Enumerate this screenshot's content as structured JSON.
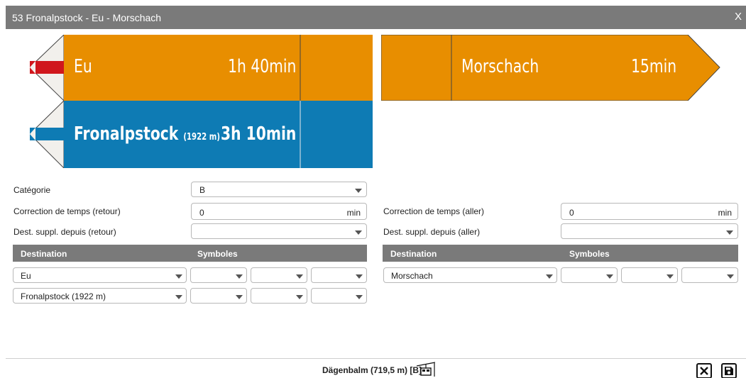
{
  "window": {
    "title": "53 Fronalpstock - Eu - Morschach",
    "close_label": "X"
  },
  "colors": {
    "orange": "#e88e00",
    "blue": "#0e7bb4",
    "red": "#d0171d",
    "header_gray": "#7a7a7a"
  },
  "signs": {
    "back_top": {
      "destination": "Eu",
      "time": "1h 40min"
    },
    "back_bottom": {
      "destination": "Fronalpstock",
      "altitude": "(1922 m)",
      "time": "3h 10min"
    },
    "forward": {
      "destination": "Morschach",
      "time": "15min"
    }
  },
  "form": {
    "category_label": "Catégorie",
    "category_value": "B",
    "correction_back_label": "Correction de temps (retour)",
    "correction_back_value": "0",
    "correction_fwd_label": "Correction de temps (aller)",
    "correction_fwd_value": "0",
    "unit": "min",
    "dest_back_label": "Dest. suppl. depuis (retour)",
    "dest_fwd_label": "Dest. suppl. depuis (aller)"
  },
  "tables": {
    "destination_header": "Destination",
    "symbols_header": "Symboles",
    "back_rows": [
      "Eu",
      "Fronalpstock (1922 m)"
    ],
    "forward_rows": [
      "Morschach"
    ]
  },
  "footer": {
    "location": "Dägenbalm (719,5 m) [B]",
    "icon": "gondola-icon",
    "cancel_icon": "close-box-icon",
    "save_icon": "save-icon"
  }
}
